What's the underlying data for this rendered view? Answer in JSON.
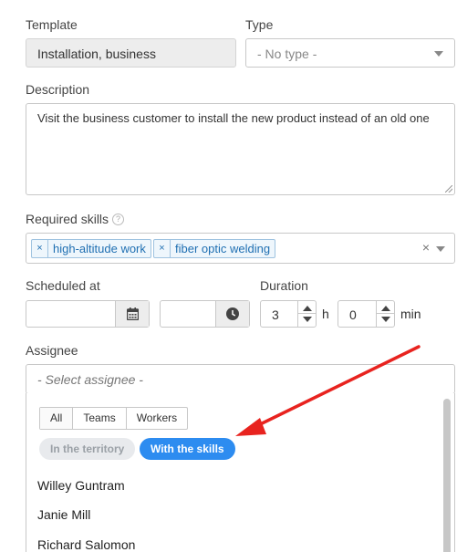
{
  "template": {
    "label": "Template",
    "value": "Installation, business"
  },
  "type": {
    "label": "Type",
    "placeholder": "- No type -"
  },
  "description": {
    "label": "Description",
    "value": "Visit the business customer to install the new product instead of an old one"
  },
  "required_skills": {
    "label": "Required skills",
    "help": "?",
    "remove_glyph": "×",
    "tags": [
      "high-altitude work",
      "fiber optic welding"
    ],
    "clear_glyph": "×"
  },
  "scheduled_at": {
    "label": "Scheduled at",
    "date_value": "",
    "time_value": ""
  },
  "duration": {
    "label": "Duration",
    "hours": "3",
    "hours_unit": "h",
    "minutes": "0",
    "minutes_unit": "min"
  },
  "assignee": {
    "label": "Assignee",
    "placeholder": "- Select assignee -",
    "filter_tabs": [
      "All",
      "Teams",
      "Workers"
    ],
    "filters": {
      "territory": "In the territory",
      "skills": "With the skills"
    },
    "workers": [
      "Willey Guntram",
      "Janie Mill",
      "Richard Salomon"
    ]
  },
  "colors": {
    "accent": "#2d8cf0",
    "annotation_arrow": "#e8231f"
  }
}
